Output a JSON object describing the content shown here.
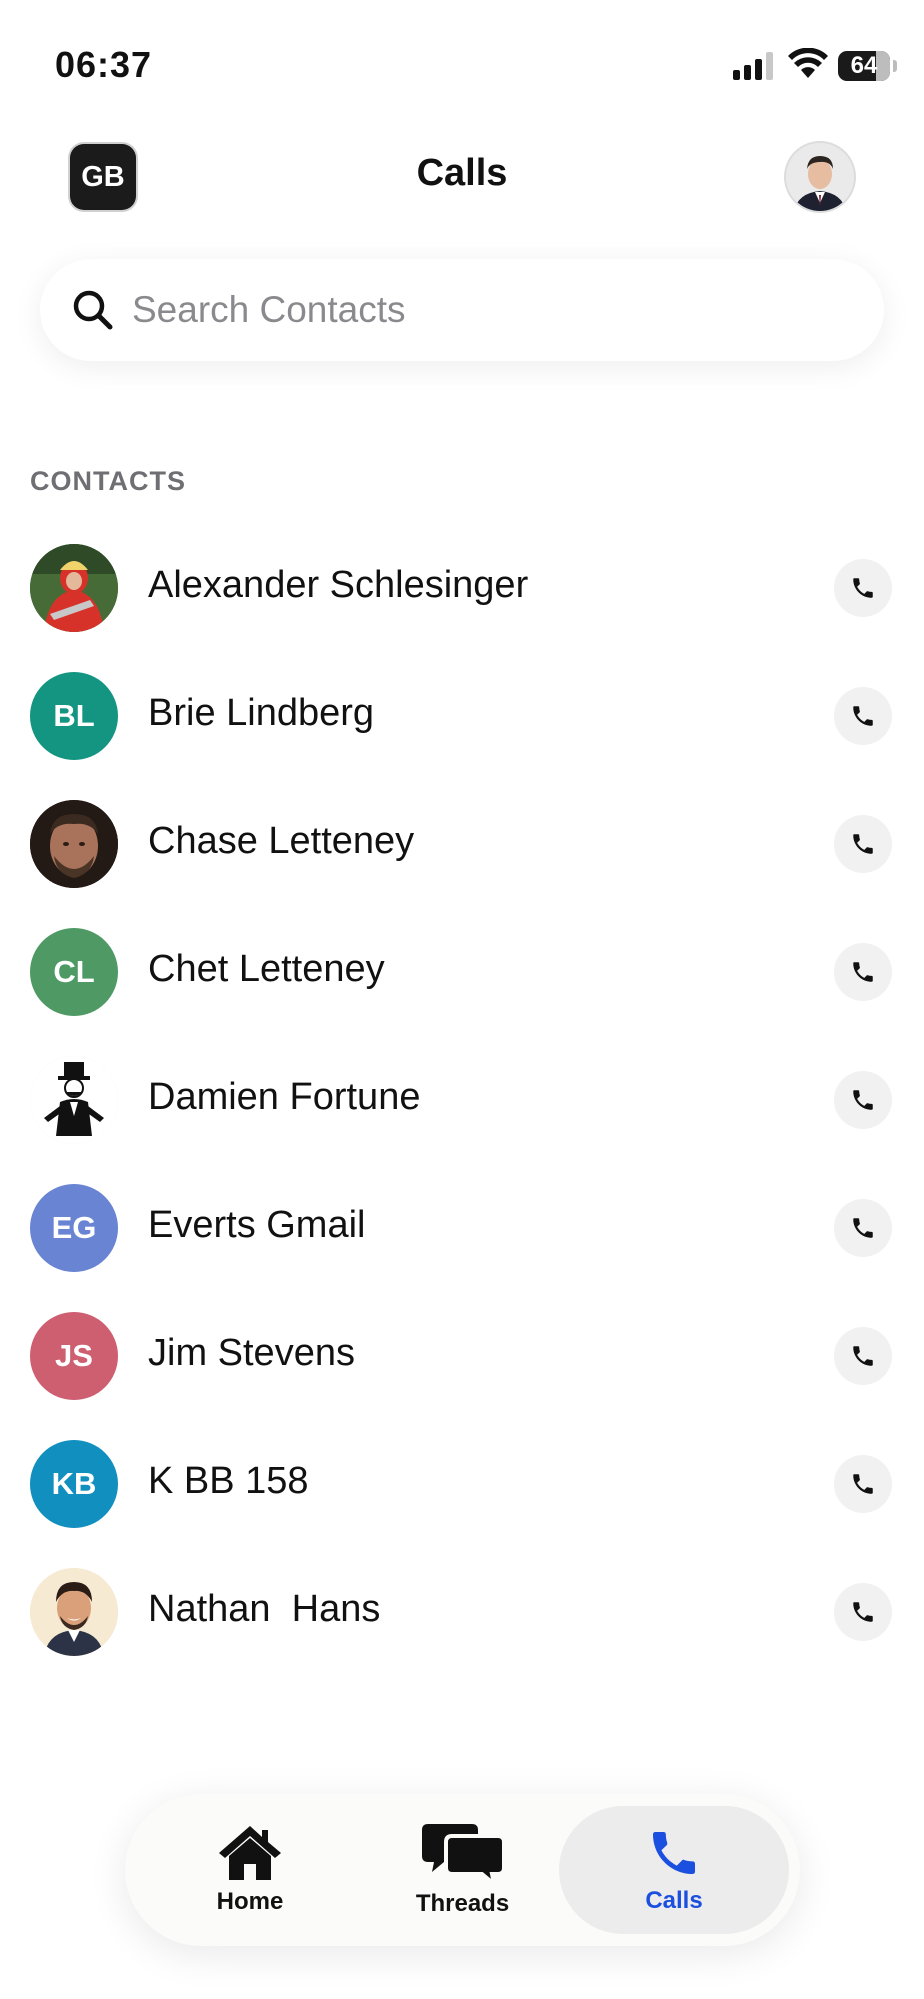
{
  "status_bar": {
    "time": "06:37",
    "battery": "64"
  },
  "header": {
    "badge": "GB",
    "title": "Calls",
    "profile_icon": "profile-photo"
  },
  "search": {
    "placeholder": "Search Contacts",
    "value": ""
  },
  "section_title": "CONTACTS",
  "contacts": [
    {
      "name": "Alexander Schlesinger",
      "initials": "",
      "avatar": "photo-red-hooded"
    },
    {
      "name": "Brie Lindberg",
      "initials": "BL",
      "color": "#139582"
    },
    {
      "name": "Chase Letteney",
      "initials": "",
      "avatar": "photo-bearded-man"
    },
    {
      "name": "Chet Letteney",
      "initials": "CL",
      "color": "#4f9a64"
    },
    {
      "name": "Damien Fortune",
      "initials": "",
      "avatar": "photo-monopoly-man"
    },
    {
      "name": "Everts Gmail",
      "initials": "EG",
      "color": "#6884d3"
    },
    {
      "name": "Jim Stevens",
      "initials": "JS",
      "color": "#cd5f70"
    },
    {
      "name": "K BB 158",
      "initials": "KB",
      "color": "#118fbe"
    },
    {
      "name": "Nathan  Hans",
      "initials": "",
      "avatar": "photo-cartoon-man"
    }
  ],
  "tabs": [
    {
      "label": "Home",
      "icon": "home-icon",
      "active": false
    },
    {
      "label": "Threads",
      "icon": "threads-icon",
      "active": false
    },
    {
      "label": "Calls",
      "icon": "phone-icon",
      "active": true
    }
  ],
  "colors": {
    "accent": "#1a4fe0",
    "badge_bg": "#1b1b1b"
  }
}
